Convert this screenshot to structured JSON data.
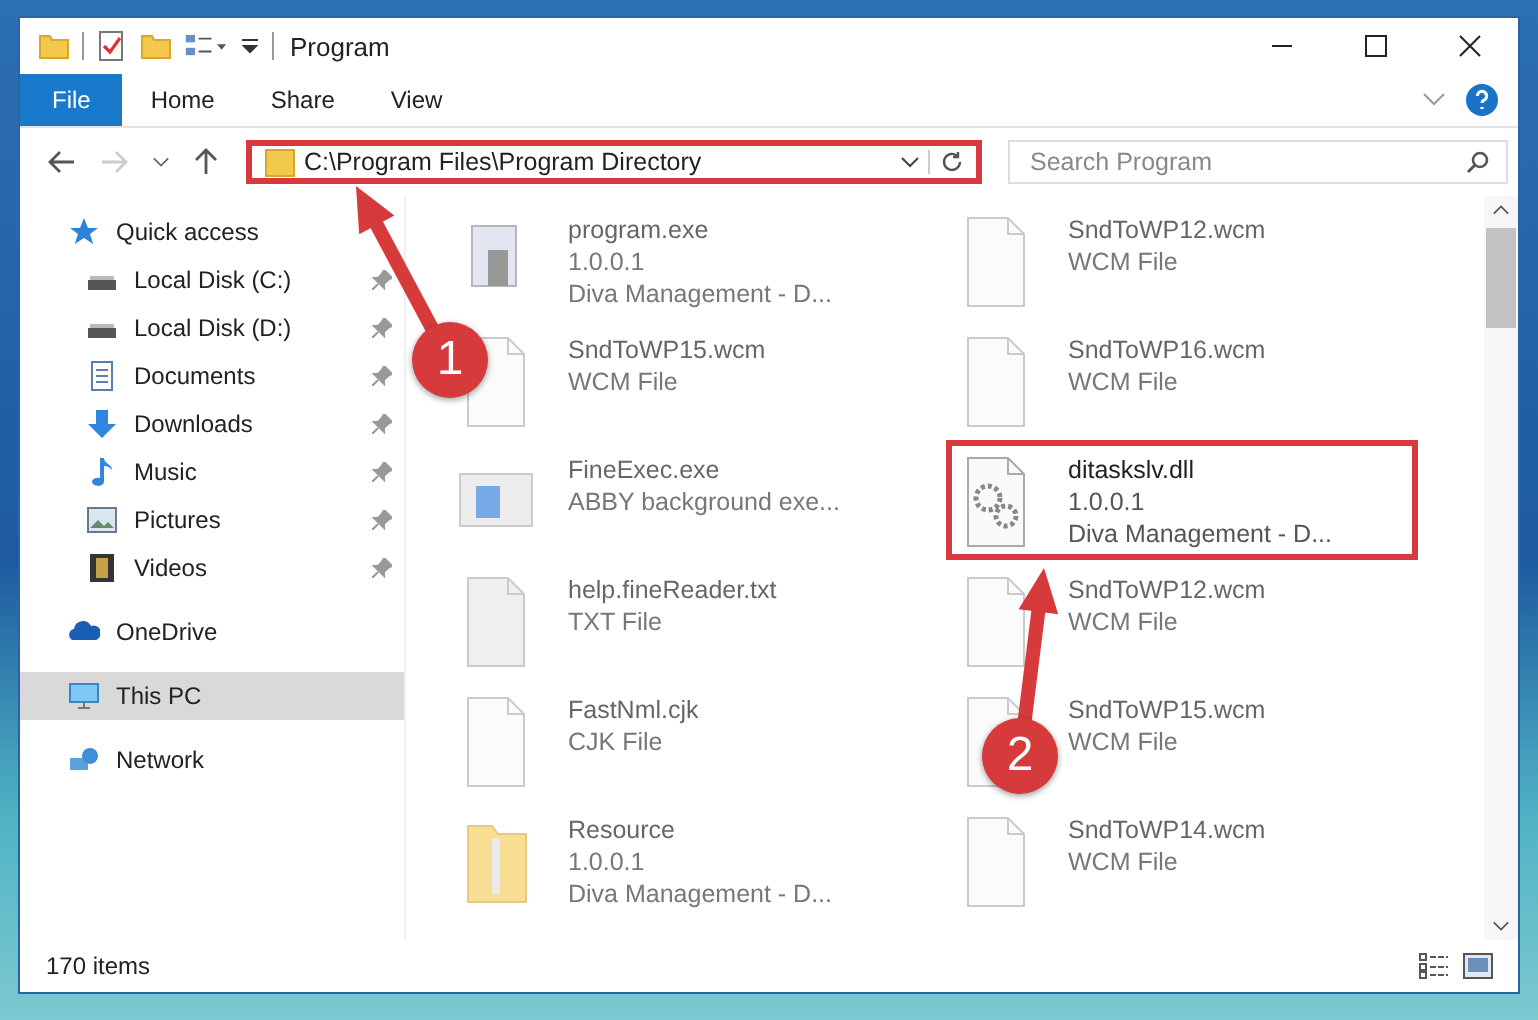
{
  "window": {
    "title": "Program"
  },
  "ribbon": {
    "tabs": [
      {
        "label": "File",
        "selected": true
      },
      {
        "label": "Home",
        "selected": false
      },
      {
        "label": "Share",
        "selected": false
      },
      {
        "label": "View",
        "selected": false
      }
    ]
  },
  "address_bar": {
    "value": "C:\\Program Files\\Program Directory",
    "highlighted": true
  },
  "search": {
    "placeholder": "Search Program"
  },
  "sidebar": {
    "items": [
      {
        "label": "Quick access",
        "kind": "star",
        "selected": false,
        "children": [
          {
            "label": "Local Disk (C:)",
            "kind": "disk",
            "selected": false,
            "pinned": true
          },
          {
            "label": "Local Disk (D:)",
            "kind": "disk",
            "selected": false,
            "pinned": true
          },
          {
            "label": "Documents",
            "kind": "documents",
            "selected": false,
            "pinned": true
          },
          {
            "label": "Downloads",
            "kind": "downloads",
            "selected": false,
            "pinned": true
          },
          {
            "label": "Music",
            "kind": "music",
            "selected": false,
            "pinned": true
          },
          {
            "label": "Pictures",
            "kind": "pictures",
            "selected": false,
            "pinned": true
          },
          {
            "label": "Videos",
            "kind": "videos",
            "selected": false,
            "pinned": true
          }
        ]
      },
      {
        "label": "OneDrive",
        "kind": "cloud",
        "selected": false
      },
      {
        "label": "This PC",
        "kind": "pc",
        "selected": true
      },
      {
        "label": "Network",
        "kind": "network",
        "selected": false
      }
    ]
  },
  "files": [
    {
      "name": "program.exe",
      "lines": [
        "1.0.0.1",
        "Diva Management - D..."
      ],
      "kind": "exe",
      "blurred": true,
      "highlighted": false
    },
    {
      "name": "SndToWP12.wcm",
      "lines": [
        "WCM File"
      ],
      "kind": "doc",
      "blurred": true,
      "highlighted": false
    },
    {
      "name": "SndToWP15.wcm",
      "lines": [
        "WCM File"
      ],
      "kind": "doc",
      "blurred": true,
      "highlighted": false
    },
    {
      "name": "SndToWP16.wcm",
      "lines": [
        "WCM File"
      ],
      "kind": "doc",
      "blurred": true,
      "highlighted": false
    },
    {
      "name": "FineExec.exe",
      "lines": [
        "ABBY background exe..."
      ],
      "kind": "app",
      "blurred": true,
      "highlighted": false
    },
    {
      "name": "ditaskslv.dll",
      "lines": [
        "1.0.0.1",
        "Diva Management - D..."
      ],
      "kind": "dll",
      "blurred": false,
      "highlighted": true
    },
    {
      "name": "help.fineReader.txt",
      "lines": [
        "TXT File"
      ],
      "kind": "txt",
      "blurred": true,
      "highlighted": false
    },
    {
      "name": "SndToWP12.wcm",
      "lines": [
        "WCM File"
      ],
      "kind": "doc",
      "blurred": true,
      "highlighted": false
    },
    {
      "name": "FastNml.cjk",
      "lines": [
        "CJK File"
      ],
      "kind": "doc",
      "blurred": true,
      "highlighted": false
    },
    {
      "name": "SndToWP15.wcm",
      "lines": [
        "WCM File"
      ],
      "kind": "doc",
      "blurred": true,
      "highlighted": false
    },
    {
      "name": "Resource",
      "lines": [
        "1.0.0.1",
        "Diva Management - D..."
      ],
      "kind": "folder",
      "blurred": true,
      "highlighted": false
    },
    {
      "name": "SndToWP14.wcm",
      "lines": [
        "WCM File"
      ],
      "kind": "doc",
      "blurred": true,
      "highlighted": false
    }
  ],
  "status_bar": {
    "count": "170 items"
  },
  "callouts": [
    {
      "label": "1"
    },
    {
      "label": "2"
    }
  ]
}
